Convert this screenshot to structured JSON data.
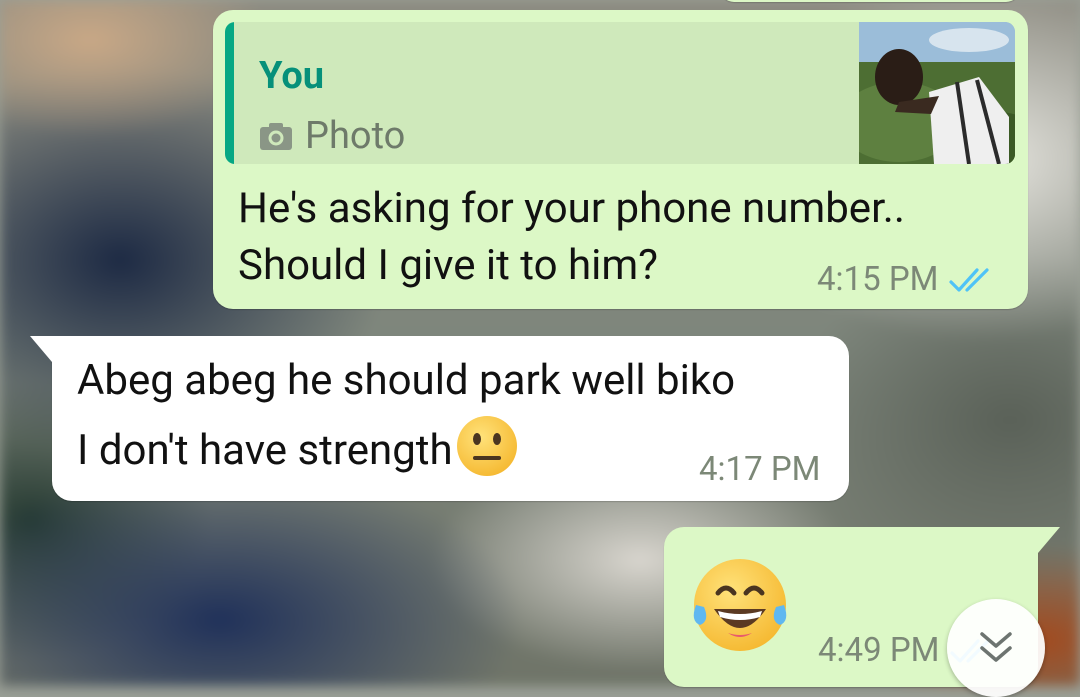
{
  "conversation": {
    "messages": [
      {
        "direction": "outgoing",
        "quoted": {
          "author": "You",
          "type_label": "Photo",
          "type_icon": "camera-icon",
          "has_thumbnail": true
        },
        "lines": [
          "He's asking for your phone number..",
          "Should I give it to him?"
        ],
        "time": "4:15 PM",
        "status": "read",
        "status_icon": "double-check-icon"
      },
      {
        "direction": "incoming",
        "lines": [
          "Abeg abeg he should park well biko",
          "I don't have strength"
        ],
        "emoji": "neutral-face-emoji",
        "time": "4:17 PM"
      },
      {
        "direction": "outgoing",
        "emoji": "face-with-tears-of-joy-emoji",
        "time": "4:49 PM",
        "status_icon": "double-check-icon"
      }
    ]
  },
  "scroll_button": {
    "icon": "double-chevron-down-icon"
  },
  "colors": {
    "outgoing_bubble": "#dcf8c6",
    "incoming_bubble": "#ffffff",
    "quote_accent": "#06a884",
    "read_tick": "#4fc3f7",
    "meta_text": "#7c8877"
  }
}
